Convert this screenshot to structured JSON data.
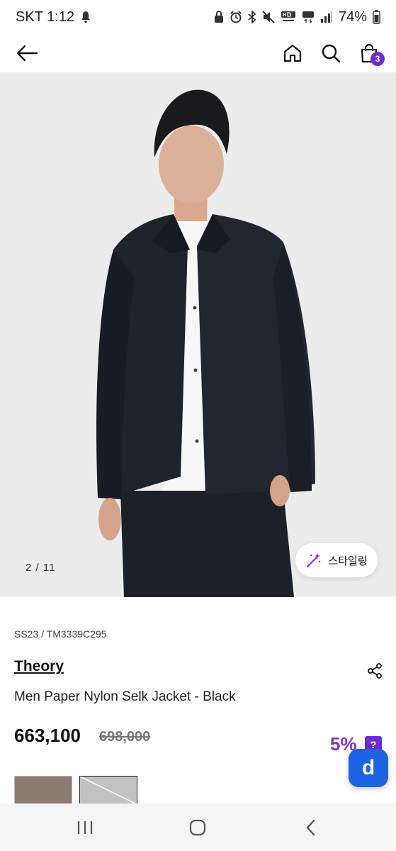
{
  "status_bar": {
    "carrier_time": "SKT 1:12",
    "battery": "74%",
    "icons": [
      "app-notification-icon",
      "lock-icon",
      "alarm-icon",
      "bluetooth-icon",
      "mute-icon",
      "hd-voice-icon",
      "5g-icon",
      "signal-icon",
      "battery-icon"
    ]
  },
  "header": {
    "icons": [
      "back-arrow-icon",
      "home-icon",
      "search-icon",
      "cart-icon"
    ],
    "cart_count": "3"
  },
  "gallery": {
    "counter": "2 / 11",
    "styling_label": "스타일링"
  },
  "product": {
    "sku": "SS23 / TM3339C295",
    "brand": "Theory",
    "name": "Men Paper Nylon Selk Jacket - Black",
    "price": "663,100",
    "original_price": "698,000",
    "discount": "5%",
    "help": "?",
    "fab_label": "d"
  },
  "nav": {
    "icons": [
      "recent-apps-icon",
      "home-circle-icon",
      "back-chevron-icon"
    ]
  },
  "colors": {
    "accent": "#6c2bd9",
    "discount": "#7d35d8",
    "fab": "#1d63e3"
  }
}
